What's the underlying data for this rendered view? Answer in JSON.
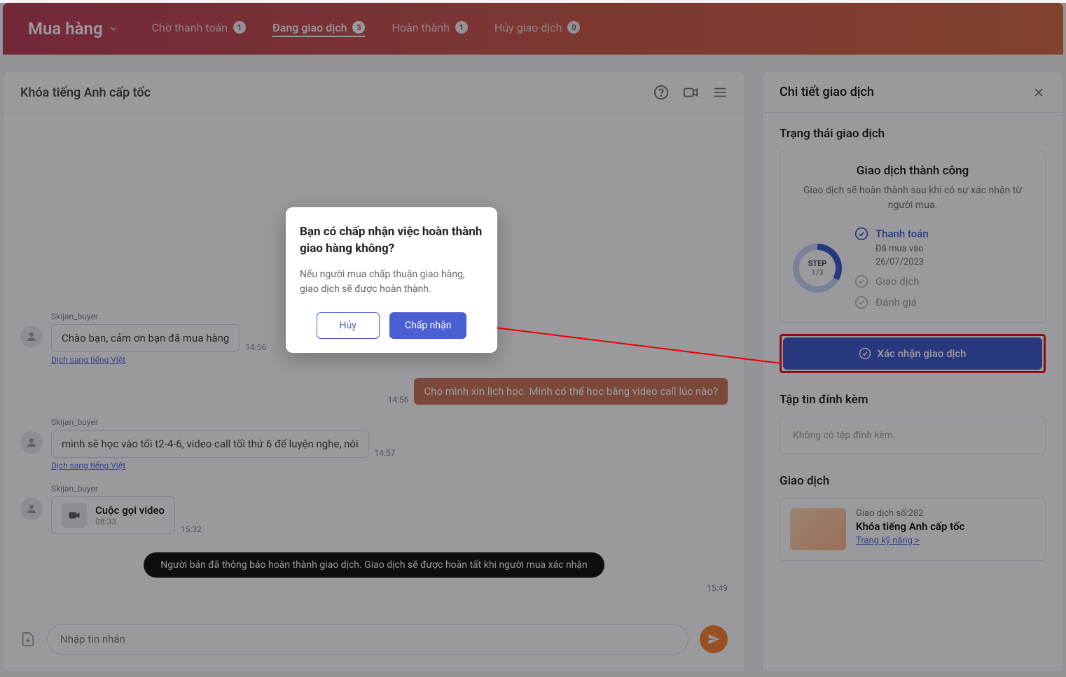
{
  "header": {
    "title": "Mua hàng",
    "tabs": [
      {
        "label": "Chờ thanh toán",
        "count": "1"
      },
      {
        "label": "Đang giao dịch",
        "count": "3"
      },
      {
        "label": "Hoàn thành",
        "count": "1"
      },
      {
        "label": "Hủy giao dịch",
        "count": "0"
      }
    ]
  },
  "chat": {
    "title": "Khóa tiếng Anh cấp tốc",
    "messages": {
      "m1": {
        "sender": "Skijan_buyer",
        "text": "Chào bạn, cảm ơn bạn đã mua hàng",
        "time": "14:56",
        "translate": "Dịch sang tiếng Việt"
      },
      "m2": {
        "text": "Cho mình xin lịch học. Mình có thể học bằng video call lúc nào?",
        "time": "14:56"
      },
      "m3": {
        "sender": "Skijan_buyer",
        "text": "mình sẽ học vào tối t2-4-6, video call tối thứ 6 để luyện nghe, nói",
        "time": "14:57",
        "translate": "Dịch sang tiếng Việt"
      },
      "m4": {
        "sender": "Skijan_buyer",
        "title": "Cuộc gọi video",
        "sub": "08:33",
        "time": "15:32"
      },
      "system": {
        "text": "Người bán đã thông báo hoàn thành giao dịch. Giao dịch sẽ được hoàn tất khi người mua xác nhận",
        "time": "15:49"
      }
    },
    "input_placeholder": "Nhập tin nhắn"
  },
  "detail": {
    "title": "Chi tiết giao dịch",
    "status_section": "Trạng thái giao dịch",
    "status": {
      "head": "Giao dịch thành công",
      "desc": "Giao dịch sẽ hoàn thành sau khi có sự xác nhận từ người mua.",
      "step_label": "STEP",
      "step_count": "1/3",
      "steps": {
        "s1": {
          "label": "Thanh toán",
          "meta1": "Đã mua vào",
          "meta2": "26/07/2023"
        },
        "s2": {
          "label": "Giao dịch"
        },
        "s3": {
          "label": "Đánh giá"
        }
      },
      "confirm": "Xác nhận giao dịch"
    },
    "attach_section": "Tập tin đính kèm",
    "attach_empty": "Không có tệp đính kèm.",
    "txn_section": "Giao dịch",
    "txn": {
      "id": "Giao dịch số:282",
      "name": "Khóa tiếng Anh cấp tốc",
      "link": "Trang kỹ năng >"
    }
  },
  "modal": {
    "title": "Bạn có chấp nhận việc hoàn thành giao hàng không?",
    "desc": "Nếu người mua chấp thuận giao hàng, giao dịch sẽ được hoàn thành.",
    "cancel": "Hủy",
    "accept": "Chấp nhận"
  }
}
